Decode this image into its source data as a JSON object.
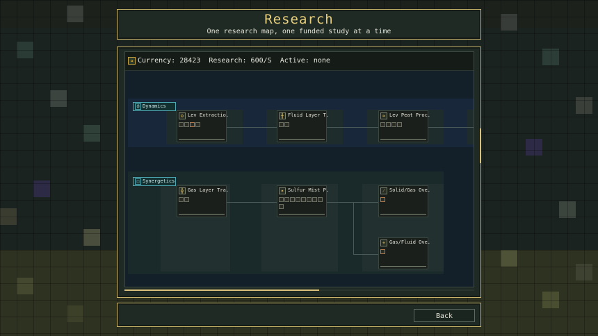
{
  "header": {
    "title": "Research",
    "subtitle": "One research map, one funded study at a time"
  },
  "status": {
    "text": "Currency: 28423  Research: 600/S  Active: none",
    "currency_icon": "coin-stack-icon"
  },
  "branches": [
    {
      "label": "Dynamics",
      "icon": "dynamics-icon",
      "nodes": [
        {
          "label": "Lev Extractio.",
          "icon": "extraction-icon"
        },
        {
          "label": "Fluid Layer T.",
          "icon": "fluid-icon"
        },
        {
          "label": "Lev Peat Proc.",
          "icon": "peat-icon"
        }
      ]
    },
    {
      "label": "Synergetics",
      "icon": "synergetics-icon",
      "nodes": [
        {
          "label": "Gas Layer Tra.",
          "icon": "gas-icon"
        },
        {
          "label": "Sulfur Mist P.",
          "icon": "sulfur-icon"
        },
        {
          "label": "Solid/Gas Ove.",
          "icon": "solid-gas-icon"
        },
        {
          "label": "Gas/Fluid Ove.",
          "icon": "gas-fluid-icon"
        }
      ]
    }
  ],
  "footer": {
    "back_label": "Back"
  },
  "colors": {
    "accent": "#e8cf7c",
    "border": "#c8b46a",
    "branch": "#4ea8b4"
  }
}
